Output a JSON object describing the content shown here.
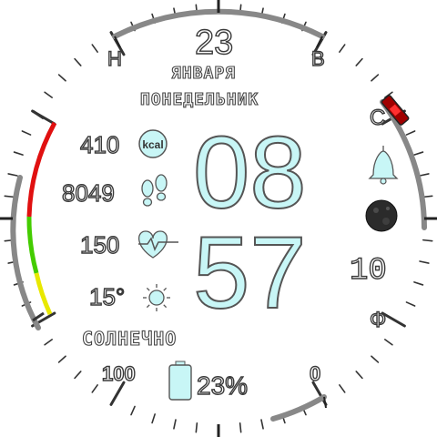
{
  "date": {
    "day": "23",
    "month": "ЯНВАРЯ",
    "weekday": "ПОНЕДЕЛЬНИК"
  },
  "time": {
    "hours": "08",
    "minutes": "57"
  },
  "stats": {
    "calories": {
      "value": "410",
      "icon": "kcal",
      "icon_name": "kcal-icon"
    },
    "steps": {
      "value": "8049",
      "icon_name": "footsteps-icon"
    },
    "heart_rate": {
      "value": "150",
      "icon_name": "heart-pulse-icon"
    },
    "temperature": {
      "value": "15°",
      "icon_name": "sun-icon"
    }
  },
  "weather": {
    "condition": "СОЛНЕЧНО"
  },
  "battery": {
    "percent_text": "23%",
    "level": 0.23
  },
  "compass": {
    "north": "Н",
    "east": "В",
    "south": "С",
    "west": "Ф",
    "heading_value": "10"
  },
  "scale": {
    "left_label": "100",
    "right_label": "0"
  },
  "colors": {
    "accent_cyan": "#c8f6f6",
    "arc_red": "#e01010",
    "arc_green": "#44cc00",
    "arc_yellow": "#e8e800",
    "gauge_gray": "#888888"
  }
}
